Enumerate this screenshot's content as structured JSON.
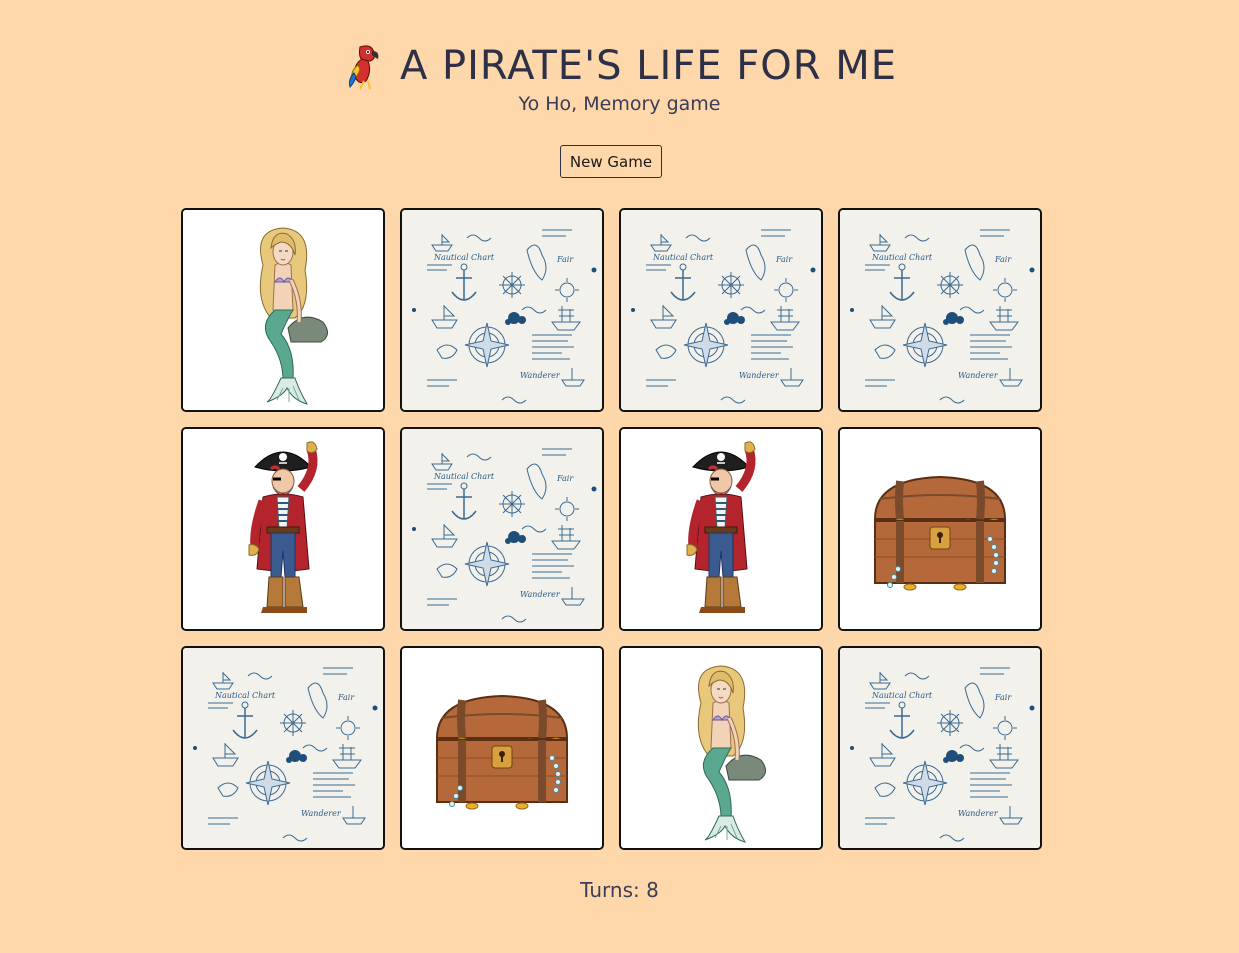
{
  "header": {
    "title": "A PIRATE'S LIFE FOR ME",
    "subtitle": "Yo Ho, Memory game",
    "icon": "parrot-icon"
  },
  "controls": {
    "new_game_label": "New Game"
  },
  "board": {
    "columns": 4,
    "rows": 3,
    "cards": [
      {
        "state": "face-up",
        "image": "mermaid"
      },
      {
        "state": "face-down",
        "image": "nautical-map-back"
      },
      {
        "state": "face-down",
        "image": "nautical-map-back"
      },
      {
        "state": "face-down",
        "image": "nautical-map-back"
      },
      {
        "state": "face-up",
        "image": "pirate-captain"
      },
      {
        "state": "face-down",
        "image": "nautical-map-back"
      },
      {
        "state": "face-up",
        "image": "pirate-captain"
      },
      {
        "state": "face-up",
        "image": "treasure-chest"
      },
      {
        "state": "face-down",
        "image": "nautical-map-back"
      },
      {
        "state": "face-up",
        "image": "treasure-chest"
      },
      {
        "state": "face-up",
        "image": "mermaid"
      },
      {
        "state": "face-down",
        "image": "nautical-map-back"
      }
    ]
  },
  "status": {
    "turns_text": "Turns: 8"
  },
  "colors": {
    "background": "#fed7aa",
    "text": "#2d3047",
    "card_border": "#111111",
    "card_back_ink": "#2b5a82"
  }
}
